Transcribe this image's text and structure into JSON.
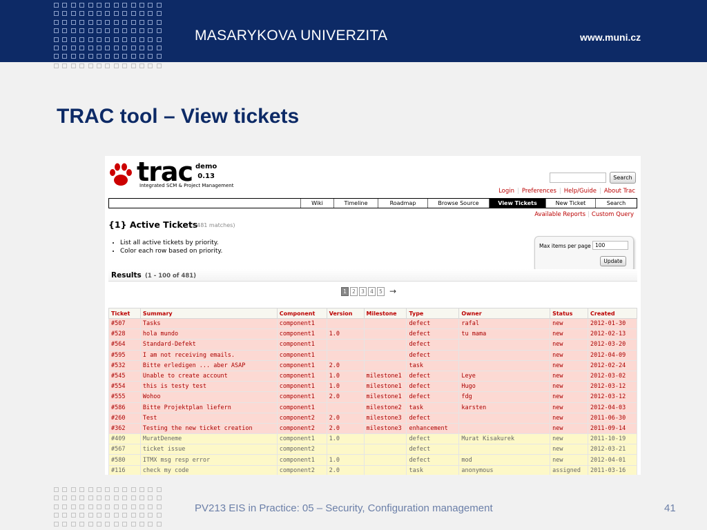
{
  "header": {
    "university": "MASARYKOVA UNIVERZITA",
    "url": "www.muni.cz"
  },
  "slide": {
    "title": "TRAC tool – View tickets",
    "footer": "PV213 EIS in Practice: 05 – Security, Configuration management",
    "page_number": "41"
  },
  "trac": {
    "logo": {
      "text": "trac",
      "subtitle": "Integrated SCM & Project Management",
      "demo_line1": "demo",
      "demo_line2": "0.13"
    },
    "search_button": "Search",
    "metanav": [
      "Login",
      "Preferences",
      "Help/Guide",
      "About Trac"
    ],
    "mainnav": [
      {
        "label": "Wiki",
        "active": false
      },
      {
        "label": "Timeline",
        "active": false
      },
      {
        "label": "Roadmap",
        "active": false
      },
      {
        "label": "Browse Source",
        "active": false
      },
      {
        "label": "View Tickets",
        "active": true
      },
      {
        "label": "New Ticket",
        "active": false
      },
      {
        "label": "Search",
        "active": false
      }
    ],
    "ctxtnav": [
      "Available Reports",
      "Custom Query"
    ],
    "report": {
      "title": "{1} Active Tickets",
      "matches": "(481 matches)",
      "description": [
        "List all active tickets by priority.",
        "Color each row based on priority."
      ]
    },
    "limit": {
      "label": "Max items per page",
      "value": "100",
      "update_button": "Update"
    },
    "results": {
      "label": "Results",
      "range": "(1 - 100 of 481)"
    },
    "pager": {
      "pages": [
        "1",
        "2",
        "3",
        "4",
        "5"
      ],
      "current": "1",
      "next_arrow": "→"
    },
    "columns": [
      "Ticket",
      "Summary",
      "Component",
      "Version",
      "Milestone",
      "Type",
      "Owner",
      "Status",
      "Created"
    ],
    "rows": [
      {
        "priority": "p1",
        "cells": [
          "#507",
          "Tasks",
          "component1",
          "",
          "",
          "defect",
          "rafal",
          "new",
          "2012-01-30"
        ]
      },
      {
        "priority": "p1",
        "cells": [
          "#528",
          "hola mundo",
          "component1",
          "1.0",
          "",
          "defect",
          "tu mama",
          "new",
          "2012-02-13"
        ]
      },
      {
        "priority": "p1",
        "cells": [
          "#564",
          "Standard-Defekt",
          "component1",
          "",
          "",
          "defect",
          "",
          "new",
          "2012-03-20"
        ]
      },
      {
        "priority": "p1",
        "cells": [
          "#595",
          "I am not receiving emails.",
          "component1",
          "",
          "",
          "defect",
          "",
          "new",
          "2012-04-09"
        ]
      },
      {
        "priority": "p1",
        "cells": [
          "#532",
          "Bitte erledigen ... aber ASAP",
          "component1",
          "2.0",
          "",
          "task",
          "",
          "new",
          "2012-02-24"
        ]
      },
      {
        "priority": "p1",
        "cells": [
          "#545",
          "Unable to create account",
          "component1",
          "1.0",
          "milestone1",
          "defect",
          "Leye",
          "new",
          "2012-03-02"
        ]
      },
      {
        "priority": "p1",
        "cells": [
          "#554",
          "this is testy test",
          "component1",
          "1.0",
          "milestone1",
          "defect",
          "Hugo",
          "new",
          "2012-03-12"
        ]
      },
      {
        "priority": "p1",
        "cells": [
          "#555",
          "Wohoo",
          "component1",
          "2.0",
          "milestone1",
          "defect",
          "fdg",
          "new",
          "2012-03-12"
        ]
      },
      {
        "priority": "p1",
        "cells": [
          "#586",
          "Bitte Projektplan liefern",
          "component1",
          "",
          "milestone2",
          "task",
          "karsten",
          "new",
          "2012-04-03"
        ]
      },
      {
        "priority": "p1",
        "cells": [
          "#260",
          "Test",
          "component2",
          "2.0",
          "milestone3",
          "defect",
          "",
          "new",
          "2011-06-30"
        ]
      },
      {
        "priority": "p1",
        "cells": [
          "#362",
          "Testing the new ticket creation",
          "component2",
          "2.0",
          "milestone3",
          "enhancement",
          "",
          "new",
          "2011-09-14"
        ]
      },
      {
        "priority": "p2",
        "cells": [
          "#409",
          "MuratDeneme",
          "component1",
          "1.0",
          "",
          "defect",
          "Murat Kisakurek",
          "new",
          "2011-10-19"
        ]
      },
      {
        "priority": "p2",
        "cells": [
          "#567",
          "ticket issue",
          "component2",
          "",
          "",
          "defect",
          "",
          "new",
          "2012-03-21"
        ]
      },
      {
        "priority": "p2",
        "cells": [
          "#580",
          "ITMX msg resp error",
          "component1",
          "1.0",
          "",
          "defect",
          "mod",
          "new",
          "2012-04-01"
        ]
      },
      {
        "priority": "p2",
        "cells": [
          "#116",
          "check my code",
          "component2",
          "2.0",
          "",
          "task",
          "anonymous",
          "assigned",
          "2011-03-16"
        ]
      }
    ]
  },
  "colors": {
    "header_bg": "#0d2a66",
    "title": "#0d2a66",
    "link_red": "#bb0000",
    "row_priority1": "#fcd9d3",
    "row_priority2": "#fdf8c8"
  }
}
